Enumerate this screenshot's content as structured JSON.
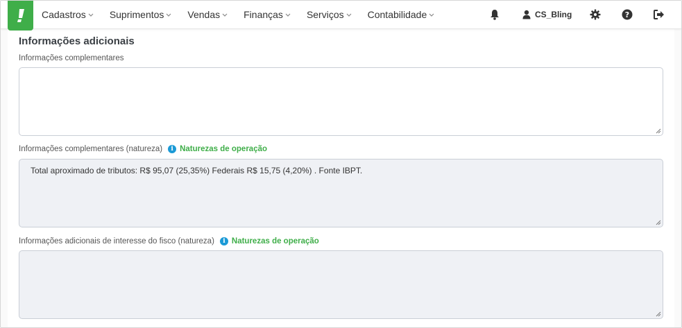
{
  "nav": {
    "items": [
      {
        "label": "Cadastros"
      },
      {
        "label": "Suprimentos"
      },
      {
        "label": "Vendas"
      },
      {
        "label": "Finanças"
      },
      {
        "label": "Serviços"
      },
      {
        "label": "Contabilidade"
      }
    ],
    "user_name": "CS_Bling",
    "icons": [
      "bell-icon",
      "user-icon",
      "gear-icon",
      "help-icon",
      "logout-icon"
    ]
  },
  "section": {
    "title": "Informações adicionais",
    "field1": {
      "label": "Informações complementares",
      "value": ""
    },
    "field2": {
      "label": "Informações complementares (natureza)",
      "link": "Naturezas de operação",
      "value": "Total aproximado de tributos: R$ 95,07 (25,35%)  Federais R$ 15,75 (4,20%)  . Fonte IBPT."
    },
    "field3": {
      "label": "Informações adicionais de interesse do fisco (natureza)",
      "link": "Naturezas de operação",
      "value": ""
    }
  },
  "colors": {
    "brand": "#3fae49",
    "info": "#1b9ad6",
    "readonly_bg": "#eff1f5"
  }
}
